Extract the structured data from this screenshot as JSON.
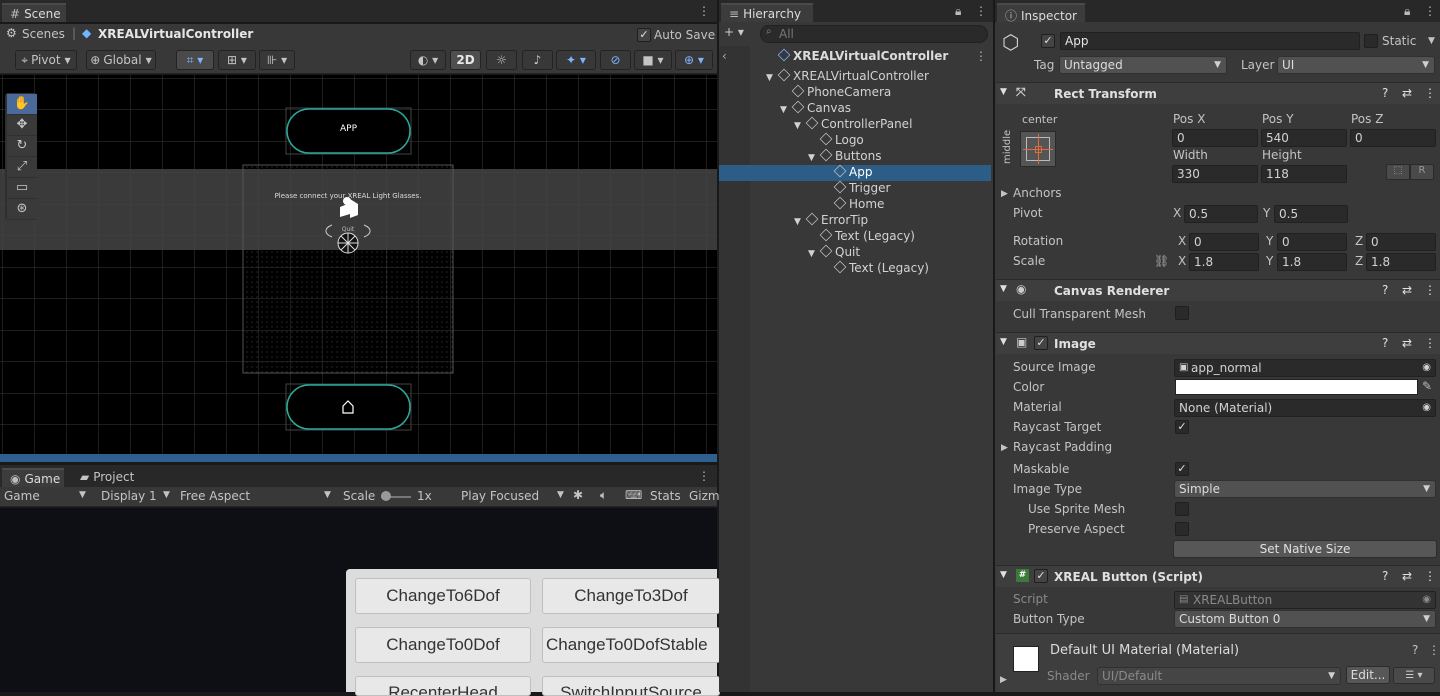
{
  "scene_tab": "Scene",
  "scene_header": {
    "scenes": "Scenes",
    "title": "XREALVirtualController",
    "autosave": "Auto Save"
  },
  "scene_toolbar": {
    "pivot": "Pivot",
    "global": "Global",
    "twod": "2D"
  },
  "scene_view": {
    "app_button": "APP",
    "error_text": "Please connect your XREAL Light Glasses.",
    "quit_text": "Quit"
  },
  "game_tabs": {
    "game": "Game",
    "project": "Project"
  },
  "game_toolbar": {
    "game": "Game",
    "display": "Display 1",
    "aspect": "Free Aspect",
    "scale_label": "Scale",
    "scale_value": "1x",
    "play": "Play Focused",
    "stats": "Stats",
    "gizmos": "Gizm"
  },
  "game_buttons": [
    "ChangeTo6Dof",
    "ChangeTo3Dof",
    "ChangeTo0Dof",
    "ChangeTo0DofStable",
    "RecenterHead",
    "SwitchInputSource"
  ],
  "hierarchy": {
    "tab": "Hierarchy",
    "search_placeholder": "All",
    "scene_root": "XREALVirtualController",
    "items": [
      {
        "label": "XREALVirtualController",
        "depth": 0,
        "fold": true
      },
      {
        "label": "PhoneCamera",
        "depth": 1,
        "fold": false
      },
      {
        "label": "Canvas",
        "depth": 1,
        "fold": true
      },
      {
        "label": "ControllerPanel",
        "depth": 2,
        "fold": true
      },
      {
        "label": "Logo",
        "depth": 3,
        "fold": false
      },
      {
        "label": "Buttons",
        "depth": 3,
        "fold": true
      },
      {
        "label": "App",
        "depth": 4,
        "fold": false,
        "selected": true
      },
      {
        "label": "Trigger",
        "depth": 4,
        "fold": false
      },
      {
        "label": "Home",
        "depth": 4,
        "fold": false
      },
      {
        "label": "ErrorTip",
        "depth": 2,
        "fold": true
      },
      {
        "label": "Text (Legacy)",
        "depth": 3,
        "fold": false
      },
      {
        "label": "Quit",
        "depth": 3,
        "fold": true
      },
      {
        "label": "Text (Legacy)",
        "depth": 4,
        "fold": false
      }
    ]
  },
  "inspector": {
    "tab": "Inspector",
    "name": "App",
    "static_label": "Static",
    "tag_label": "Tag",
    "tag_value": "Untagged",
    "layer_label": "Layer",
    "layer_value": "UI",
    "rect": {
      "title": "Rect Transform",
      "anchor_h": "center",
      "anchor_v": "middle",
      "posx_label": "Pos X",
      "posy_label": "Pos Y",
      "posz_label": "Pos Z",
      "posx": "0",
      "posy": "540",
      "posz": "0",
      "width_label": "Width",
      "height_label": "Height",
      "width": "330",
      "height": "118",
      "r_button": "R",
      "anchors": "Anchors",
      "pivot": "Pivot",
      "pivot_x": "0.5",
      "pivot_y": "0.5",
      "rotation": "Rotation",
      "rot_x": "0",
      "rot_y": "0",
      "rot_z": "0",
      "scale": "Scale",
      "scale_x": "1.8",
      "scale_y": "1.8",
      "scale_z": "1.8",
      "x": "X",
      "y": "Y",
      "z": "Z"
    },
    "canvas_renderer": {
      "title": "Canvas Renderer",
      "cull": "Cull Transparent Mesh"
    },
    "image": {
      "title": "Image",
      "source_label": "Source Image",
      "source": "app_normal",
      "color_label": "Color",
      "material_label": "Material",
      "material": "None (Material)",
      "raycast_target": "Raycast Target",
      "raycast_padding": "Raycast Padding",
      "maskable": "Maskable",
      "image_type_label": "Image Type",
      "image_type": "Simple",
      "use_sprite_mesh": "Use Sprite Mesh",
      "preserve_aspect": "Preserve Aspect",
      "set_native": "Set Native Size"
    },
    "xreal_button": {
      "title": "XREAL Button (Script)",
      "script_label": "Script",
      "script": "XREALButton",
      "button_type_label": "Button Type",
      "button_type": "Custom Button 0"
    },
    "material": {
      "title": "Default UI Material (Material)",
      "shader_label": "Shader",
      "shader": "UI/Default",
      "edit": "Edit..."
    }
  }
}
